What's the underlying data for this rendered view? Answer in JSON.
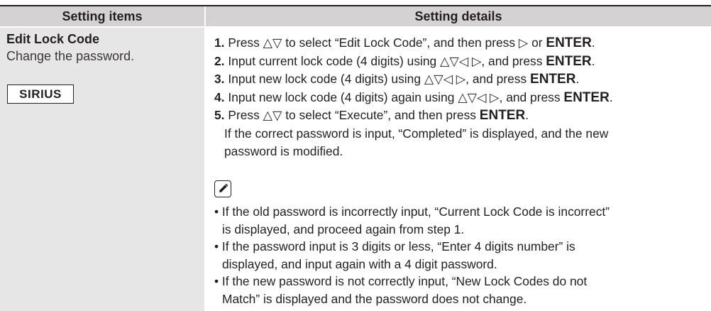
{
  "header": {
    "col1": "Setting items",
    "col2": "Setting details"
  },
  "item": {
    "title": "Edit Lock Code",
    "description": "Change the password.",
    "badge": "SIRIUS"
  },
  "steps": [
    {
      "num": "1.",
      "before": "Press △▽ to select “Edit Lock Code”, and then press ▷ or ",
      "kw": "ENTER",
      "after": "."
    },
    {
      "num": "2.",
      "before": "Input current lock code (4 digits) using △▽◁ ▷, and press ",
      "kw": "ENTER",
      "after": "."
    },
    {
      "num": "3.",
      "before": "Input new lock code (4 digits) using △▽◁ ▷, and press ",
      "kw": "ENTER",
      "after": "."
    },
    {
      "num": "4.",
      "before": "Input new lock code (4 digits) again using △▽◁ ▷, and press ",
      "kw": "ENTER",
      "after": "."
    },
    {
      "num": "5.",
      "before": "Press △▽ to select “Execute”, and then press ",
      "kw": "ENTER",
      "after": "."
    }
  ],
  "result_note": [
    "If the correct password is input, “Completed” is displayed, and the new",
    "password is modified."
  ],
  "note_icon": "pencil-note-icon",
  "bullets": [
    {
      "line1": "• If the old password is incorrectly input, “Current Lock Code is incorrect”",
      "line2": "is displayed, and proceed again from step 1."
    },
    {
      "line1": "• If the password input is 3 digits or less, “Enter 4 digits number” is",
      "line2": "displayed, and input again with a 4 digit password."
    },
    {
      "line1": "• If the new password is not correctly input, “New Lock Codes do not",
      "line2": "Match” is displayed and the password does not change."
    }
  ]
}
